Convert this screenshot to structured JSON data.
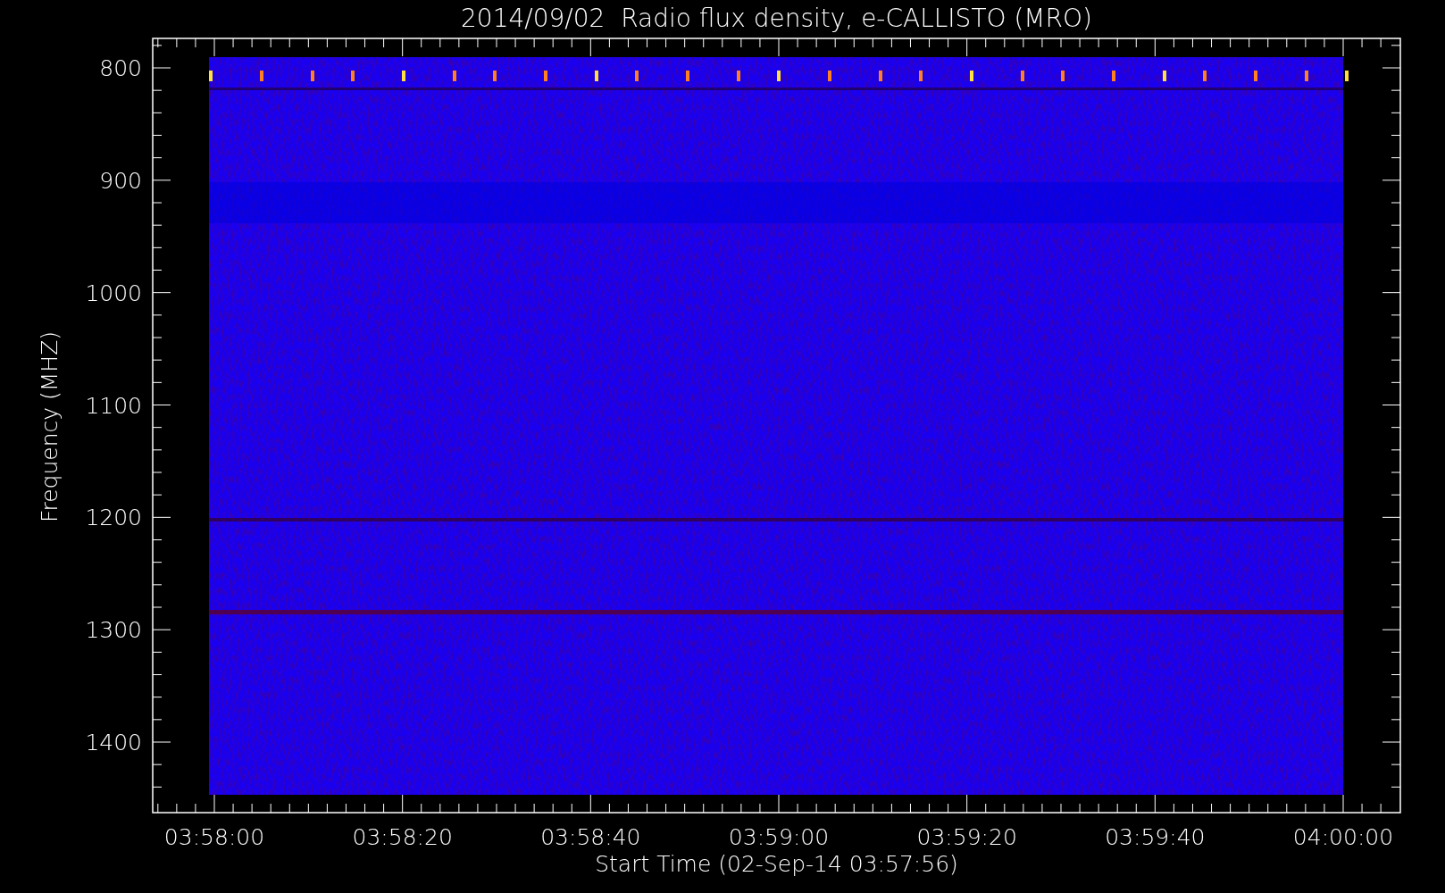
{
  "title": "2014/09/02  Radio flux density, e-CALLISTO (MRO)",
  "y_axis": {
    "label": "Frequency (MHZ)",
    "ticks": [
      "800",
      "900",
      "1000",
      "1100",
      "1200",
      "1300",
      "1400"
    ]
  },
  "x_axis": {
    "label": "Start Time (02-Sep-14 03:57:56)",
    "ticks": [
      "03:58:00",
      "03:58:20",
      "03:58:40",
      "03:59:00",
      "03:59:20",
      "03:59:40",
      "04:00:00"
    ]
  }
}
